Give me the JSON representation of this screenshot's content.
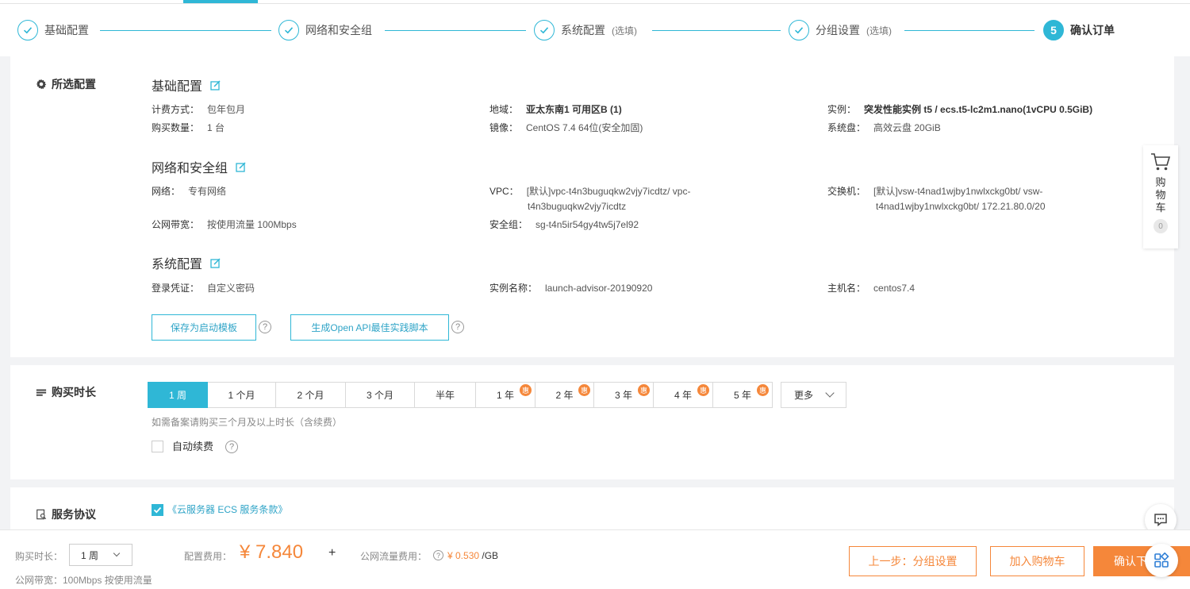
{
  "stepper": {
    "steps": [
      {
        "label": "基础配置",
        "optional": ""
      },
      {
        "label": "网络和安全组",
        "optional": ""
      },
      {
        "label": "系统配置",
        "optional": "(选填)"
      },
      {
        "label": "分组设置",
        "optional": "(选填)"
      },
      {
        "label": "确认订单",
        "optional": "",
        "number": "5"
      }
    ]
  },
  "selected_config": {
    "title": "所选配置",
    "basic": {
      "title": "基础配置",
      "billing_label": "计费方式：",
      "billing_value": "包年包月",
      "region_label": "地域：",
      "region_value": "亚太东南1 可用区B (1)",
      "instance_label": "实例：",
      "instance_value": "突发性能实例 t5 / ecs.t5-lc2m1.nano(1vCPU 0.5GiB)",
      "qty_label": "购买数量：",
      "qty_value": "1 台",
      "image_label": "镜像：",
      "image_value": "CentOS 7.4 64位(安全加固)",
      "disk_label": "系统盘：",
      "disk_value": "高效云盘 20GiB"
    },
    "network": {
      "title": "网络和安全组",
      "net_label": "网络：",
      "net_value": "专有网络",
      "vpc_label": "VPC：",
      "vpc_value_1": "[默认]vpc-t4n3buguqkw2vjy7icdtz/ vpc-",
      "vpc_value_2": "t4n3buguqkw2vjy7icdtz",
      "switch_label": "交换机：",
      "switch_value_1": "[默认]vsw-t4nad1wjby1nwlxckg0bt/ vsw-",
      "switch_value_2": "t4nad1wjby1nwlxckg0bt/ 172.21.80.0/20",
      "bandwidth_label": "公网带宽：",
      "bandwidth_value": "按使用流量 100Mbps",
      "sg_label": "安全组：",
      "sg_value": "sg-t4n5ir54gy4tw5j7el92"
    },
    "system": {
      "title": "系统配置",
      "login_label": "登录凭证：",
      "login_value": "自定义密码",
      "name_label": "实例名称：",
      "name_value": "launch-advisor-20190920",
      "host_label": "主机名：",
      "host_value": "centos7.4"
    },
    "save_template_label": "保存为启动模板",
    "gen_api_label": "生成Open API最佳实践脚本"
  },
  "duration": {
    "title": "购买时长",
    "options": [
      {
        "label": "1 周",
        "badge": ""
      },
      {
        "label": "1 个月",
        "badge": ""
      },
      {
        "label": "2 个月",
        "badge": ""
      },
      {
        "label": "3 个月",
        "badge": ""
      },
      {
        "label": "半年",
        "badge": ""
      },
      {
        "label": "1 年",
        "badge": "惠"
      },
      {
        "label": "2 年",
        "badge": "惠"
      },
      {
        "label": "3 年",
        "badge": "惠"
      },
      {
        "label": "4 年",
        "badge": "惠"
      },
      {
        "label": "5 年",
        "badge": "惠"
      }
    ],
    "selected": "1 周",
    "more_label": "更多",
    "hint": "如需备案请购买三个月及以上时长（含续费）",
    "auto_renew_label": "自动续费"
  },
  "agreement": {
    "title": "服务协议",
    "link": "《云服务器 ECS 服务条款》"
  },
  "cart": {
    "label": "购物车",
    "count": "0"
  },
  "bottom_bar": {
    "duration_label": "购买时长：",
    "duration_value": "1 周",
    "bandwidth_note": "公网带宽：100Mbps 按使用流量",
    "config_fee_label": "配置费用：",
    "config_fee": "¥ 7.840",
    "plus": "+",
    "traffic_fee_label": "公网流量费用：",
    "traffic_fee": "¥ 0.530",
    "traffic_unit": "/GB",
    "prev_label": "上一步：分组设置",
    "add_cart_label": "加入购物车",
    "confirm_label": "确认下单"
  },
  "colors": {
    "accent": "#2fb7d6",
    "orange": "#f5873a"
  }
}
